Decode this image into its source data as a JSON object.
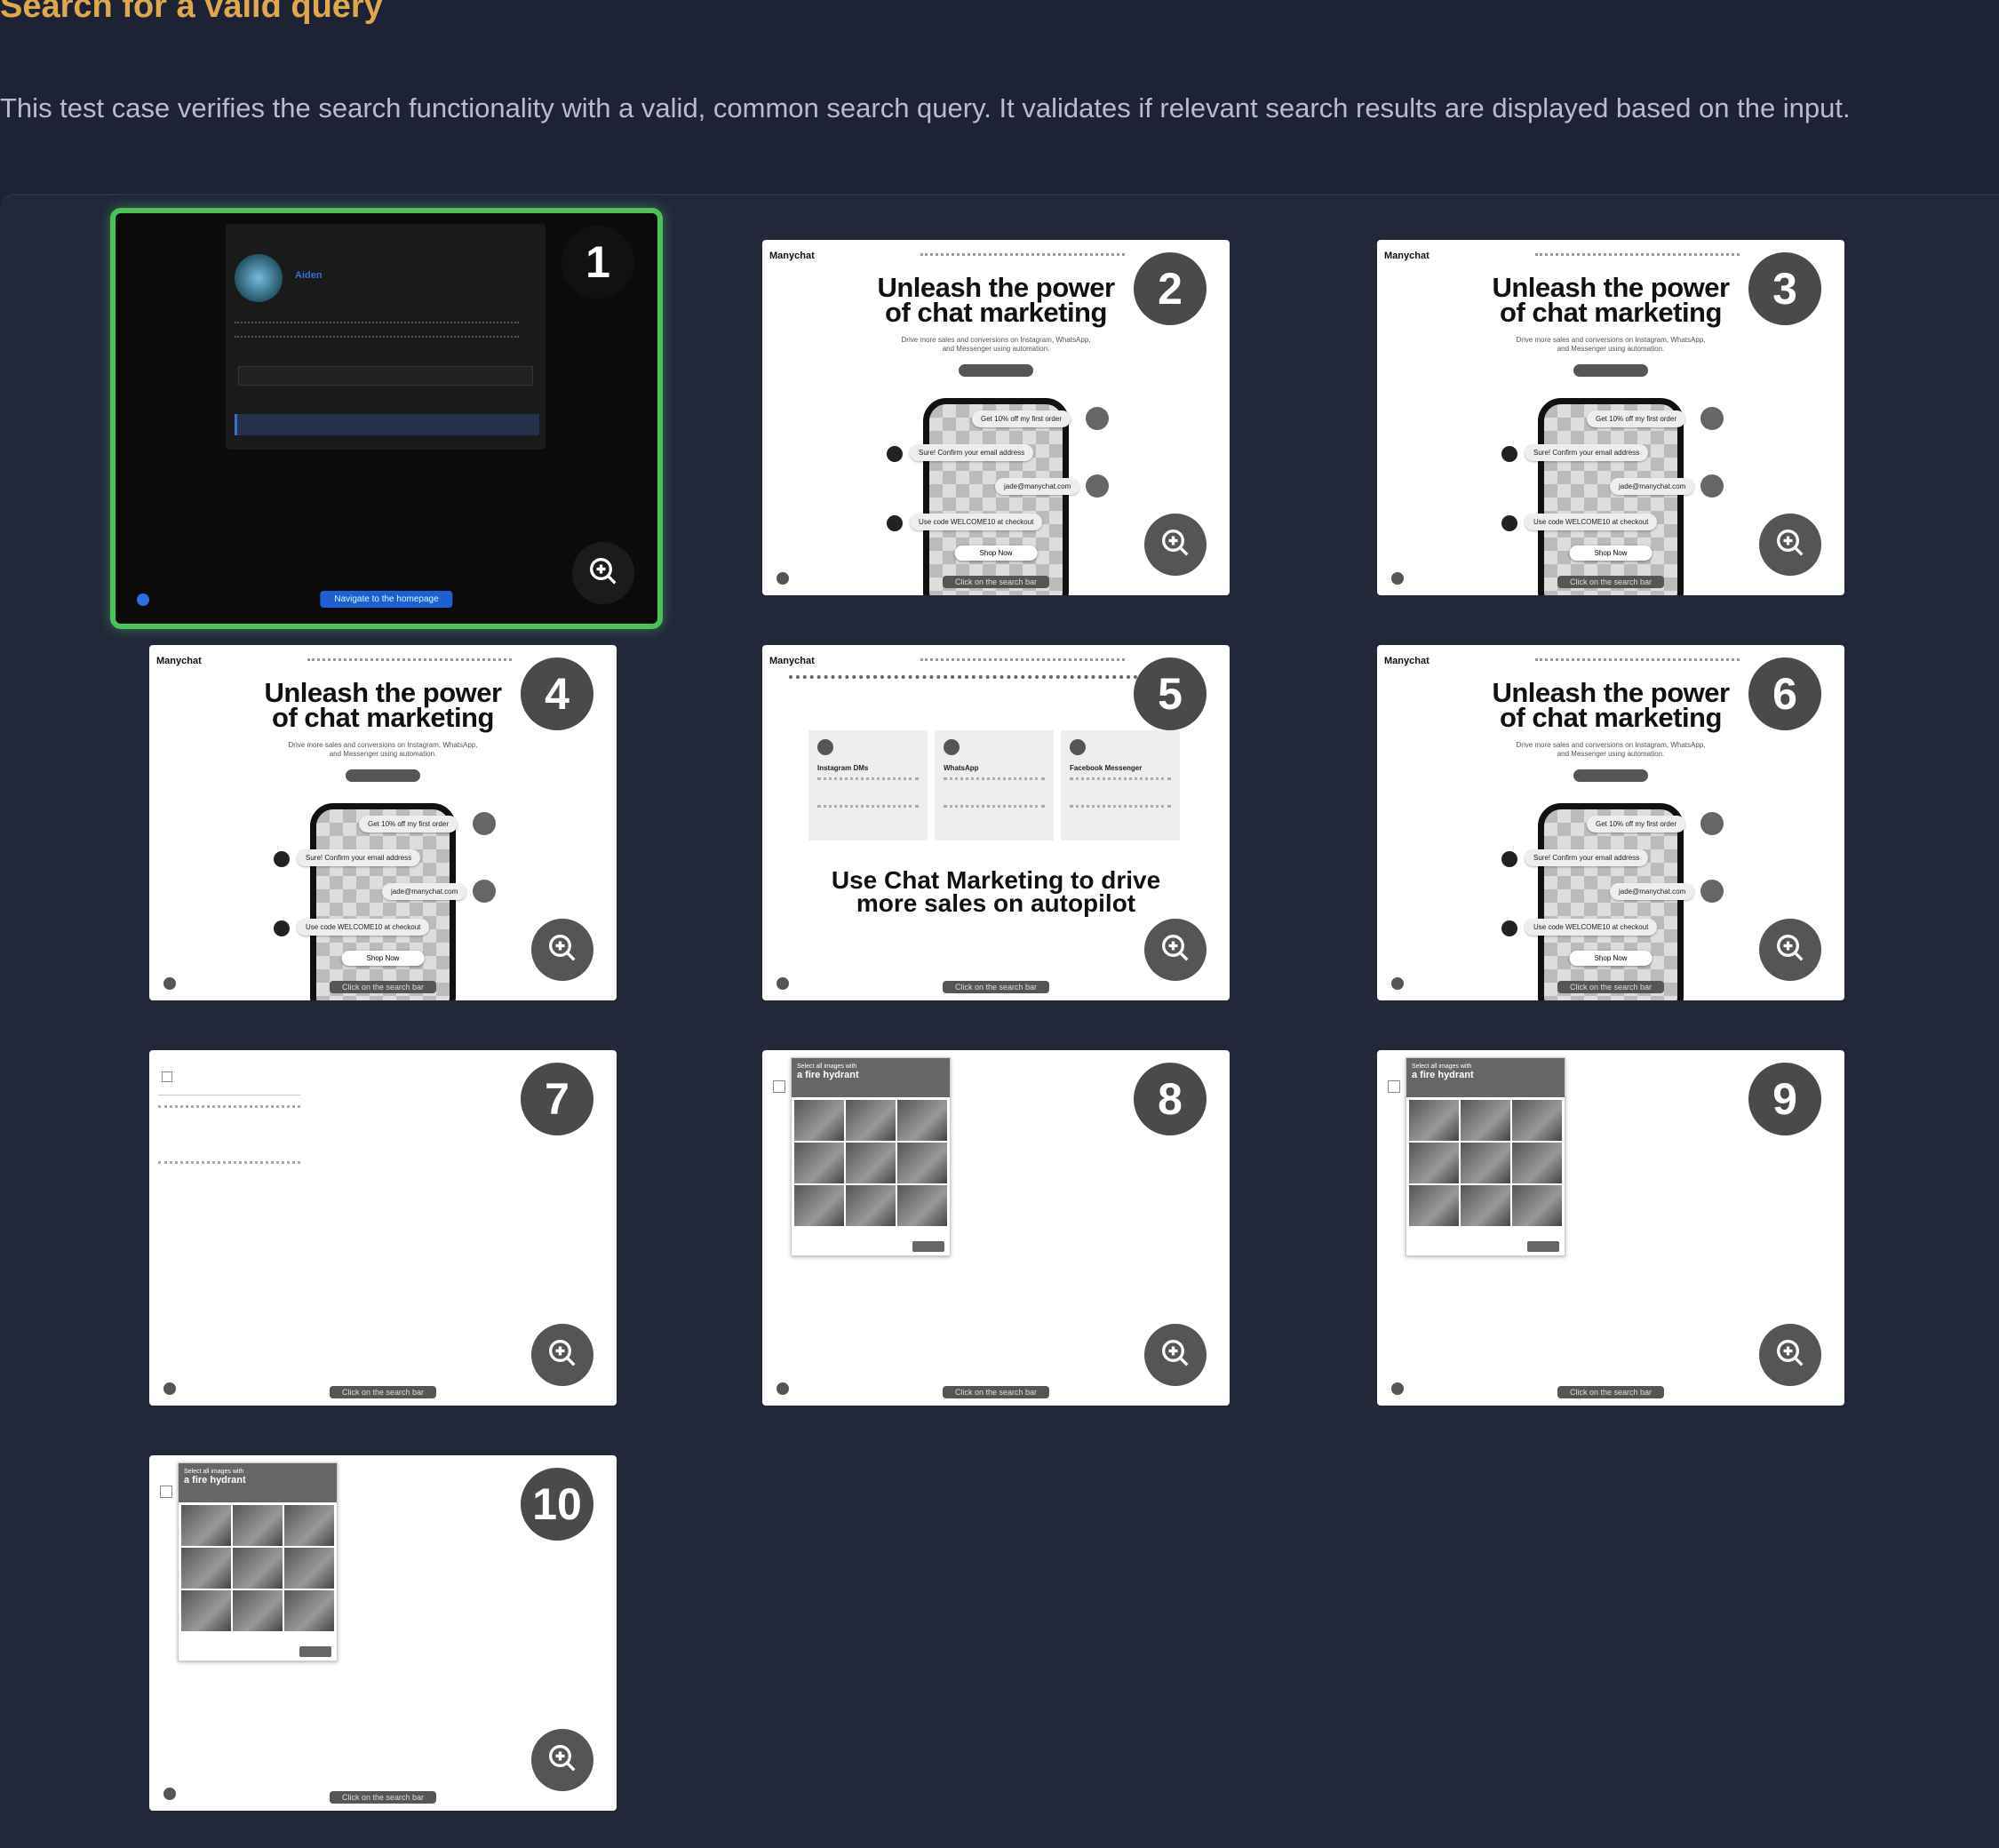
{
  "header": {
    "title": "Search for a valid query",
    "description": "This test case verifies the search functionality with a valid, common search query. It validates if relevant search results are displayed based on the input."
  },
  "steps": [
    {
      "number": "1",
      "kind": "dark",
      "caption": "Navigate to the homepage",
      "selected": true
    },
    {
      "number": "2",
      "kind": "hero",
      "caption": "Click on the search bar"
    },
    {
      "number": "3",
      "kind": "hero",
      "caption": "Click on the search bar"
    },
    {
      "number": "4",
      "kind": "hero",
      "caption": "Click on the search bar"
    },
    {
      "number": "5",
      "kind": "features",
      "caption": "Click on the search bar"
    },
    {
      "number": "6",
      "kind": "hero",
      "caption": "Click on the search bar"
    },
    {
      "number": "7",
      "kind": "blank",
      "caption": "Click on the search bar"
    },
    {
      "number": "8",
      "kind": "captcha",
      "caption": "Click on the search bar"
    },
    {
      "number": "9",
      "kind": "captcha",
      "caption": "Click on the search bar"
    },
    {
      "number": "10",
      "kind": "captcha",
      "caption": "Click on the search bar"
    }
  ],
  "hero": {
    "logo": "Manychat",
    "headline_1": "Unleash the power",
    "headline_2": "of chat marketing",
    "sub_1": "Drive more sales and conversions on Instagram, WhatsApp,",
    "sub_2": "and Messenger using automation.",
    "bubble_offer": "Get 10% off my first order",
    "bubble_confirm": "Sure! Confirm your email address",
    "bubble_email": "jade@manychat.com",
    "bubble_code": "Use code WELCOME10 at checkout",
    "shop": "Shop Now"
  },
  "features": {
    "headline": "Use Chat Marketing to drive more sales on autopilot",
    "cols": [
      "Instagram DMs",
      "WhatsApp",
      "Facebook Messenger"
    ]
  },
  "captcha": {
    "title_small": "Select all images with",
    "title_big": "a fire hydrant"
  },
  "dark_card": {
    "name": "Aiden"
  }
}
